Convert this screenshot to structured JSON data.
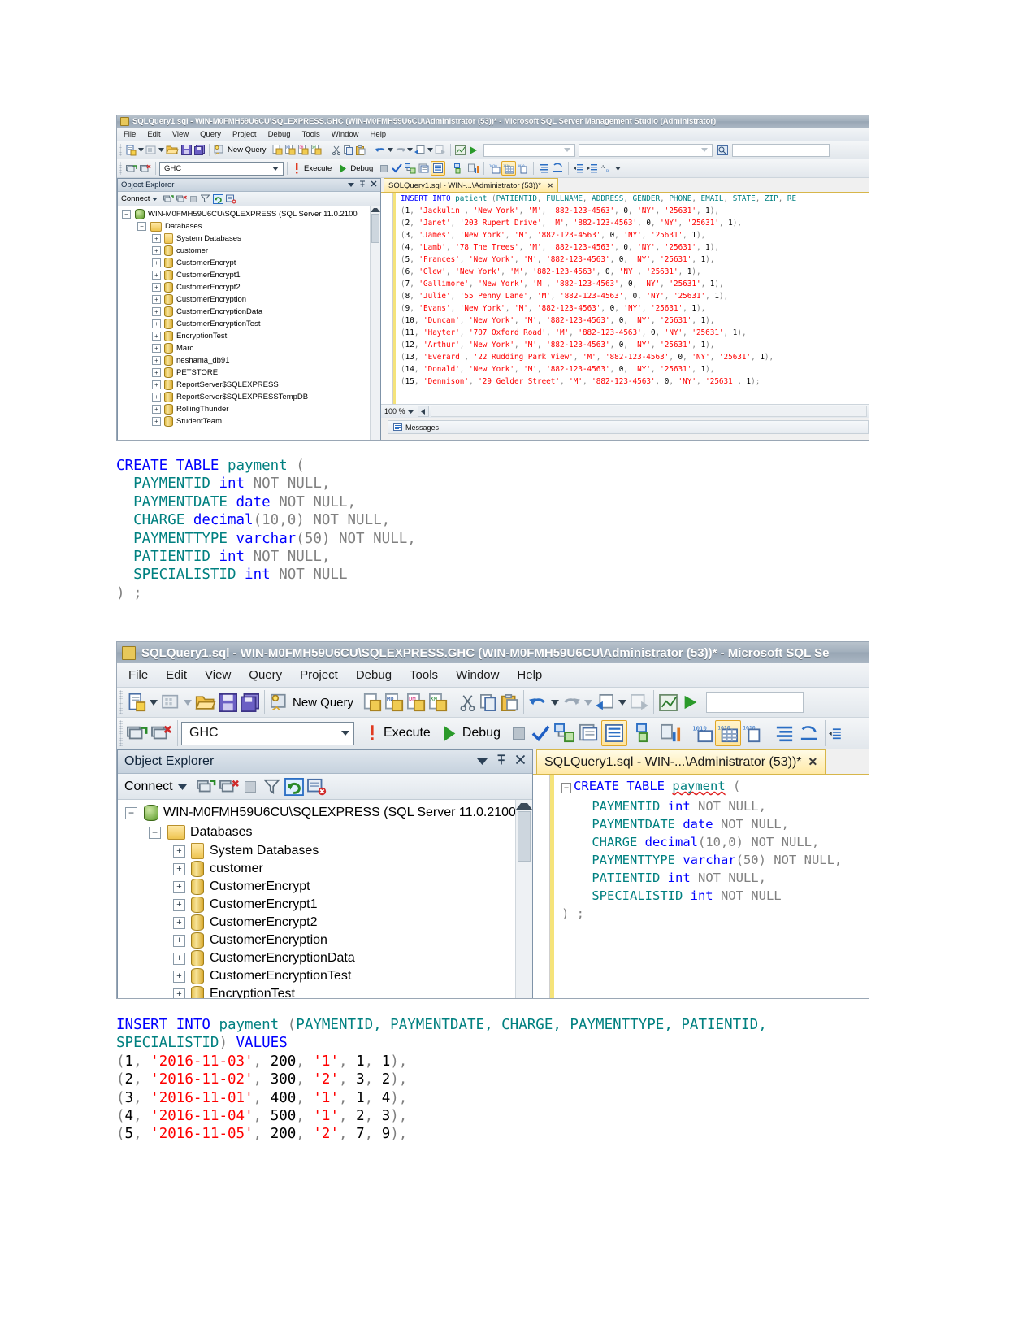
{
  "document": {
    "page_background": "#ffffff"
  },
  "screenshot_top": {
    "titlebar": {
      "icon": "sql-file-icon",
      "text": "SQLQuery1.sql - WIN-M0FMH59U6CU\\SQLEXPRESS.GHC (WIN-M0FMH59U6CU\\Administrator (53))* - Microsoft SQL Server Management Studio (Administrator)"
    },
    "menu": [
      "File",
      "Edit",
      "View",
      "Query",
      "Project",
      "Debug",
      "Tools",
      "Window",
      "Help"
    ],
    "toolbar_main": {
      "new_query_label": "New Query",
      "icons": [
        "new-item-icon",
        "new-project-icon",
        "open-file-icon",
        "save-icon",
        "save-all-icon",
        "new-query-icon",
        "new-db-engine-query-icon",
        "new-analysis-mdx-query-icon",
        "new-analysis-dmx-query-icon",
        "new-analysis-xmla-query-icon",
        "cut-icon",
        "copy-icon",
        "paste-icon",
        "undo-icon",
        "redo-icon",
        "navigate-backward-icon",
        "navigate-forward-icon",
        "summary-icon",
        "start-debug-icon"
      ]
    },
    "toolbar_query": {
      "database_value": "GHC",
      "execute_label": "Execute",
      "debug_label": "Debug",
      "icons": [
        "connect-icon",
        "disconnect-icon",
        "execute-icon",
        "debug-icon",
        "stop-icon",
        "parse-icon",
        "display-estimated-plan-icon",
        "query-options-icon",
        "include-actual-plan-icon",
        "include-client-statistics-icon",
        "results-to-text-icon",
        "results-to-grid-icon",
        "results-to-file-icon",
        "comment-icon",
        "uncomment-icon",
        "decrease-indent-icon",
        "increase-indent-icon",
        "specify-values-icon"
      ]
    },
    "object_explorer": {
      "title": "Object Explorer",
      "connect_label": "Connect",
      "toolbar_icons": [
        "connect-icon",
        "disconnect-icon",
        "stop-icon",
        "filter-icon",
        "refresh-icon",
        "reset-view-icon"
      ],
      "header_icons": [
        "dropdown-icon",
        "pin-icon",
        "close-icon"
      ],
      "server_node": "WIN-M0FMH59U6CU\\SQLEXPRESS (SQL Server 11.0.2100",
      "databases_node": "Databases",
      "databases": [
        "System Databases",
        "customer",
        "CustomerEncrypt",
        "CustomerEncrypt1",
        "CustomerEncrypt2",
        "CustomerEncryption",
        "CustomerEncryptionData",
        "CustomerEncryptionTest",
        "EncryptionTest",
        "Marc",
        "neshama_db91",
        "PETSTORE",
        "ReportServer$SQLEXPRESS",
        "ReportServer$SQLEXPRESSTempDB",
        "RollingThunder",
        "StudentTeam"
      ]
    },
    "editor": {
      "tab_label": "SQLQuery1.sql - WIN-...\\Administrator (53))*",
      "tab_close": "✕",
      "zoom_value": "100 %",
      "messages_tab": "Messages",
      "sql_lines": [
        [
          {
            "t": "INSERT INTO ",
            "c": "k"
          },
          {
            "t": "patient ",
            "c": "tl"
          },
          {
            "t": "(",
            "c": "pn"
          },
          {
            "t": "PATIENTID",
            "c": "tl"
          },
          {
            "t": ", ",
            "c": "pn"
          },
          {
            "t": "FULLNAME",
            "c": "tl"
          },
          {
            "t": ", ",
            "c": "pn"
          },
          {
            "t": "ADDRESS",
            "c": "tl"
          },
          {
            "t": ", ",
            "c": "pn"
          },
          {
            "t": "GENDER",
            "c": "tl"
          },
          {
            "t": ", ",
            "c": "pn"
          },
          {
            "t": "PHONE",
            "c": "tl"
          },
          {
            "t": ", ",
            "c": "pn"
          },
          {
            "t": "EMAIL",
            "c": "tl"
          },
          {
            "t": ", ",
            "c": "pn"
          },
          {
            "t": "STATE",
            "c": "tl"
          },
          {
            "t": ", ",
            "c": "pn"
          },
          {
            "t": "ZIP",
            "c": "tl"
          },
          {
            "t": ", ",
            "c": "pn"
          },
          {
            "t": "RE",
            "c": "tl"
          }
        ]
      ],
      "rows": [
        {
          "id": "1",
          "name": "'Jackulin'",
          "address": "'New York'",
          "gender": "'M'",
          "phone": "'882-123-4563'",
          "email": "0",
          "state": "'NY'",
          "zip": "'25631'",
          "ref": "1",
          "end": "),"
        },
        {
          "id": "2",
          "name": "'Janet'",
          "address": "'203 Rupert Drive'",
          "gender": "'M'",
          "phone": "'882-123-4563'",
          "email": "0",
          "state": "'NY'",
          "zip": "'25631'",
          "ref": "1",
          "end": "),"
        },
        {
          "id": "3",
          "name": "'James'",
          "address": "'New York'",
          "gender": "'M'",
          "phone": "'882-123-4563'",
          "email": "0",
          "state": "'NY'",
          "zip": "'25631'",
          "ref": "1",
          "end": "),"
        },
        {
          "id": "4",
          "name": "'Lamb'",
          "address": "'78 The Trees'",
          "gender": "'M'",
          "phone": "'882-123-4563'",
          "email": "0",
          "state": "'NY'",
          "zip": "'25631'",
          "ref": "1",
          "end": "),"
        },
        {
          "id": "5",
          "name": "'Frances'",
          "address": "'New York'",
          "gender": "'M'",
          "phone": "'882-123-4563'",
          "email": "0",
          "state": "'NY'",
          "zip": "'25631'",
          "ref": "1",
          "end": "),"
        },
        {
          "id": "6",
          "name": "'Glew'",
          "address": "'New York'",
          "gender": "'M'",
          "phone": "'882-123-4563'",
          "email": "0",
          "state": "'NY'",
          "zip": "'25631'",
          "ref": "1",
          "end": "),"
        },
        {
          "id": "7",
          "name": "'Gallimore'",
          "address": "'New York'",
          "gender": "'M'",
          "phone": "'882-123-4563'",
          "email": "0",
          "state": "'NY'",
          "zip": "'25631'",
          "ref": "1",
          "end": "),"
        },
        {
          "id": "8",
          "name": "'Julie'",
          "address": "'55 Penny Lane'",
          "gender": "'M'",
          "phone": "'882-123-4563'",
          "email": "0",
          "state": "'NY'",
          "zip": "'25631'",
          "ref": "1",
          "end": "),"
        },
        {
          "id": "9",
          "name": "'Evans'",
          "address": "'New York'",
          "gender": "'M'",
          "phone": "'882-123-4563'",
          "email": "0",
          "state": "'NY'",
          "zip": "'25631'",
          "ref": "1",
          "end": "),"
        },
        {
          "id": "10",
          "name": "'Duncan'",
          "address": "'New York'",
          "gender": "'M'",
          "phone": "'882-123-4563'",
          "email": "0",
          "state": "'NY'",
          "zip": "'25631'",
          "ref": "1",
          "end": "),"
        },
        {
          "id": "11",
          "name": "'Hayter'",
          "address": "'707 Oxford Road'",
          "gender": "'M'",
          "phone": "'882-123-4563'",
          "email": "0",
          "state": "'NY'",
          "zip": "'25631'",
          "ref": "1",
          "end": "),"
        },
        {
          "id": "12",
          "name": "'Arthur'",
          "address": "'New York'",
          "gender": "'M'",
          "phone": "'882-123-4563'",
          "email": "0",
          "state": "'NY'",
          "zip": "'25631'",
          "ref": "1",
          "end": "),"
        },
        {
          "id": "13",
          "name": "'Everard'",
          "address": "'22 Rudding Park View'",
          "gender": "'M'",
          "phone": "'882-123-4563'",
          "email": "0",
          "state": "'NY'",
          "zip": "'25631'",
          "ref": "1",
          "end": "),"
        },
        {
          "id": "14",
          "name": "'Donald'",
          "address": "'New York'",
          "gender": "'M'",
          "phone": "'882-123-4563'",
          "email": "0",
          "state": "'NY'",
          "zip": "'25631'",
          "ref": "1",
          "end": "),"
        },
        {
          "id": "15",
          "name": "'Dennison'",
          "address": "'29 Gelder Street'",
          "gender": "'M'",
          "phone": "'882-123-4563'",
          "email": "0",
          "state": "'NY'",
          "zip": "'25631'",
          "ref": "1",
          "end": ");"
        }
      ]
    }
  },
  "create_table_block": {
    "line1": {
      "create": "CREATE TABLE",
      "table": "payment",
      "paren": "("
    },
    "columns": [
      {
        "name": "PAYMENTID",
        "type": "int",
        "size": "",
        "nullability": "NOT NULL,"
      },
      {
        "name": "PAYMENTDATE",
        "type": "date",
        "size": "",
        "nullability": "NOT NULL,"
      },
      {
        "name": "CHARGE",
        "type": "decimal",
        "size": "(10,0)",
        "nullability": "NOT NULL,"
      },
      {
        "name": "PAYMENTTYPE",
        "type": "varchar",
        "size": "(50)",
        "nullability": "NOT NULL,"
      },
      {
        "name": "PATIENTID",
        "type": "int",
        "size": "",
        "nullability": "NOT NULL,"
      },
      {
        "name": "SPECIALISTID",
        "type": "int",
        "size": "",
        "nullability": "NOT NULL"
      }
    ],
    "closing": ") ;"
  },
  "screenshot_bottom": {
    "titlebar": {
      "icon": "sql-file-icon",
      "text": "SQLQuery1.sql - WIN-M0FMH59U6CU\\SQLEXPRESS.GHC (WIN-M0FMH59U6CU\\Administrator (53))* - Microsoft SQL Se"
    },
    "menu": [
      "File",
      "Edit",
      "View",
      "Query",
      "Project",
      "Debug",
      "Tools",
      "Window",
      "Help"
    ],
    "toolbar_main": {
      "new_query_label": "New Query"
    },
    "toolbar_query": {
      "database_value": "GHC",
      "execute_label": "Execute",
      "debug_label": "Debug"
    },
    "object_explorer": {
      "title": "Object Explorer",
      "connect_label": "Connect",
      "server_node": "WIN-M0FMH59U6CU\\SQLEXPRESS (SQL Server 11.0.2100",
      "databases_node": "Databases",
      "databases": [
        "System Databases",
        "customer",
        "CustomerEncrypt",
        "CustomerEncrypt1",
        "CustomerEncrypt2",
        "CustomerEncryption",
        "CustomerEncryptionData",
        "CustomerEncryptionTest",
        "EncryptionTest"
      ]
    },
    "editor": {
      "tab_label": "SQLQuery1.sql - WIN-...\\Administrator (53))*",
      "tab_close": "✕",
      "collapse_glyph": "−"
    }
  },
  "insert_payment_block": {
    "header": {
      "keyword1": "INSERT INTO",
      "table": "payment",
      "open": "(",
      "columns": "PAYMENTID, PAYMENTDATE, CHARGE, PAYMENTTYPE, PATIENTID,",
      "columns_line2": "SPECIALISTID",
      "close": ")",
      "values_keyword": "VALUES"
    },
    "rows": [
      {
        "id": "1",
        "date": "'2016-11-03'",
        "charge": "200",
        "type": "'1'",
        "patient": "1",
        "specialist": "1",
        "end": "),"
      },
      {
        "id": "2",
        "date": "'2016-11-02'",
        "charge": "300",
        "type": "'2'",
        "patient": "3",
        "specialist": "2",
        "end": "),"
      },
      {
        "id": "3",
        "date": "'2016-11-01'",
        "charge": "400",
        "type": "'1'",
        "patient": "1",
        "specialist": "4",
        "end": "),"
      },
      {
        "id": "4",
        "date": "'2016-11-04'",
        "charge": "500",
        "type": "'1'",
        "patient": "2",
        "specialist": "3",
        "end": "),"
      },
      {
        "id": "5",
        "date": "'2016-11-05'",
        "charge": "200",
        "type": "'2'",
        "patient": "7",
        "specialist": "9",
        "end": "),"
      }
    ]
  }
}
